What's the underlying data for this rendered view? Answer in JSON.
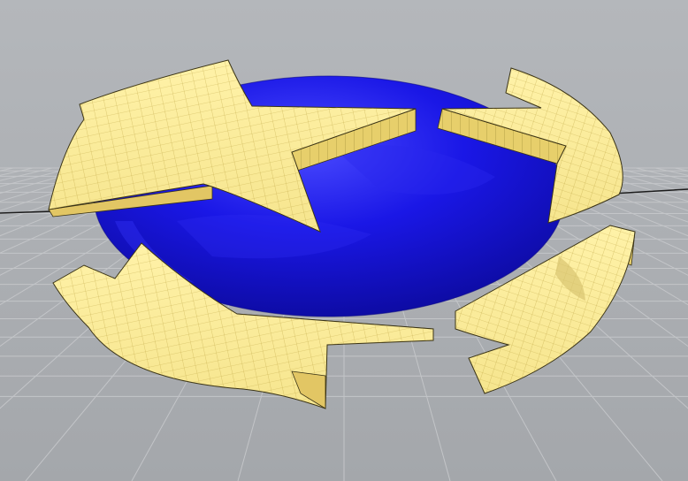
{
  "viewport": {
    "background_top": "#b4b7bb",
    "background_bottom": "#a4a7ab",
    "grid_color": "#c3c5c8",
    "axis_color": "#1c1c1c"
  },
  "model": {
    "sphere_color": "#1a17e6",
    "sphere_highlight": "#4a4aff",
    "sphere_shadow": "#0c0a9c",
    "arrow_fill": "#f6e58e",
    "arrow_fill_light": "#fff2a8",
    "arrow_side": "#e7cf6b",
    "arrow_wire": "#b59a36",
    "arrow_edge": "#3a3315",
    "icon": "recycle-arrows-mesh"
  }
}
